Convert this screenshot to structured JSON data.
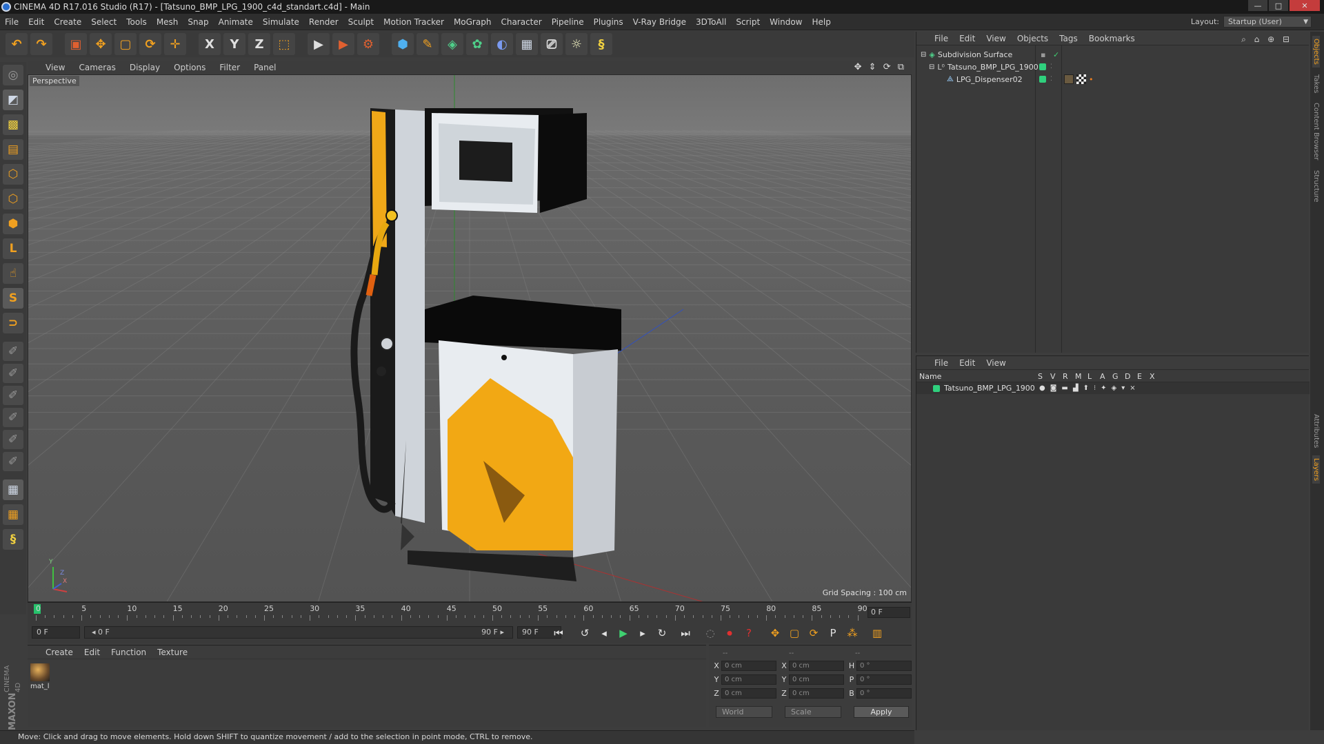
{
  "window": {
    "title": "CINEMA 4D R17.016 Studio (R17) - [Tatsuno_BMP_LPG_1900_c4d_standart.c4d] - Main",
    "buttons": [
      "—",
      "□",
      "✕"
    ]
  },
  "menubar": {
    "items": [
      "File",
      "Edit",
      "Create",
      "Select",
      "Tools",
      "Mesh",
      "Snap",
      "Animate",
      "Simulate",
      "Render",
      "Sculpt",
      "Motion Tracker",
      "MoGraph",
      "Character",
      "Pipeline",
      "Plugins",
      "V-Ray Bridge",
      "3DToAll",
      "Script",
      "Window",
      "Help"
    ],
    "layout_label": "Layout:",
    "layout_value": "Startup (User)"
  },
  "toolbar": {
    "buttons": [
      {
        "name": "undo-icon",
        "glyph": "↶"
      },
      {
        "name": "redo-icon",
        "glyph": "↷"
      },
      {
        "name": "select-icon",
        "glyph": "▣"
      },
      {
        "name": "move-icon",
        "glyph": "✥"
      },
      {
        "name": "scale-icon",
        "glyph": "▢"
      },
      {
        "name": "rotate-icon",
        "glyph": "⟳"
      },
      {
        "name": "transform-icon",
        "glyph": "✛"
      },
      {
        "name": "x-axis-icon",
        "glyph": "X"
      },
      {
        "name": "y-axis-icon",
        "glyph": "Y"
      },
      {
        "name": "z-axis-icon",
        "glyph": "Z"
      },
      {
        "name": "coord-system-icon",
        "glyph": "⬚"
      },
      {
        "name": "render-view-icon",
        "glyph": "▶"
      },
      {
        "name": "render-picture-icon",
        "glyph": "▶"
      },
      {
        "name": "render-settings-icon",
        "glyph": "⚙"
      },
      {
        "name": "cube-icon",
        "glyph": "⬢"
      },
      {
        "name": "pen-icon",
        "glyph": "✎"
      },
      {
        "name": "subdivision-icon",
        "glyph": "◈"
      },
      {
        "name": "mograph-icon",
        "glyph": "✿"
      },
      {
        "name": "deformer-icon",
        "glyph": "◐"
      },
      {
        "name": "floor-icon",
        "glyph": "▦"
      },
      {
        "name": "camera-icon",
        "glyph": "⎚"
      },
      {
        "name": "light-icon",
        "glyph": "☼"
      },
      {
        "name": "python-icon",
        "glyph": "§"
      }
    ]
  },
  "lefttools": [
    {
      "name": "make-editable-icon",
      "glyph": "◎"
    },
    {
      "name": "model-mode-icon",
      "glyph": "◩"
    },
    {
      "name": "texture-mode-icon",
      "glyph": "▩"
    },
    {
      "name": "workplane-icon",
      "glyph": "▤"
    },
    {
      "name": "points-mode-icon",
      "glyph": "⬡"
    },
    {
      "name": "edges-mode-icon",
      "glyph": "⬡"
    },
    {
      "name": "polygons-mode-icon",
      "glyph": "⬢"
    },
    {
      "name": "axis-mode-icon",
      "glyph": "L"
    },
    {
      "name": "tweak-icon",
      "glyph": "☝"
    },
    {
      "name": "snap-icon",
      "glyph": "S"
    },
    {
      "name": "magnet-icon",
      "glyph": "⊃"
    },
    {
      "name": "brush-1-icon",
      "glyph": "✐"
    },
    {
      "name": "brush-2-icon",
      "glyph": "✐"
    },
    {
      "name": "brush-3-icon",
      "glyph": "✐"
    },
    {
      "name": "brush-4-icon",
      "glyph": "✐"
    },
    {
      "name": "brush-5-icon",
      "glyph": "✐"
    },
    {
      "name": "brush-6-icon",
      "glyph": "✐"
    },
    {
      "name": "lock-grid-icon",
      "glyph": "▦"
    },
    {
      "name": "grid-snap-icon",
      "glyph": "▦"
    },
    {
      "name": "python-script-icon",
      "glyph": "§"
    }
  ],
  "maxon": {
    "line1": "MAXON",
    "line2": "CINEMA 4D"
  },
  "viewport": {
    "menu": [
      "View",
      "Cameras",
      "Display",
      "Options",
      "Filter",
      "Panel"
    ],
    "nav_icons": "✥ ⇕ ⟳ ⧉",
    "label": "Perspective",
    "grid_spacing": "Grid Spacing : 100 cm",
    "axis_y": "Y",
    "axis_z": "Z",
    "axis_x": "X"
  },
  "timeline": {
    "ticks": [
      "0",
      "5",
      "10",
      "15",
      "20",
      "25",
      "30",
      "35",
      "40",
      "45",
      "50",
      "55",
      "60",
      "65",
      "70",
      "75",
      "80",
      "85",
      "90"
    ],
    "current_frame": "0 F"
  },
  "transport": {
    "start": "0 F",
    "scrub_left": "◂ 0 F",
    "scrub_right": "90 F ▸",
    "end": "90 F",
    "buttons": [
      {
        "name": "goto-start-icon",
        "glyph": "⏮"
      },
      {
        "name": "prev-key-icon",
        "glyph": "↺"
      },
      {
        "name": "prev-frame-icon",
        "glyph": "◂"
      },
      {
        "name": "play-icon",
        "glyph": "▶"
      },
      {
        "name": "next-frame-icon",
        "glyph": "▸"
      },
      {
        "name": "loop-icon",
        "glyph": "↻"
      },
      {
        "name": "goto-end-icon",
        "glyph": "⏭"
      },
      {
        "name": "record-off-icon",
        "glyph": "◌"
      },
      {
        "name": "record-icon",
        "glyph": "⏺"
      },
      {
        "name": "autokey-icon",
        "glyph": "?"
      },
      {
        "name": "key-move-icon",
        "glyph": "✥"
      },
      {
        "name": "key-scale-icon",
        "glyph": "▢"
      },
      {
        "name": "key-rotate-icon",
        "glyph": "⟳"
      },
      {
        "name": "key-param-icon",
        "glyph": "P"
      },
      {
        "name": "key-pla-icon",
        "glyph": "⁂"
      },
      {
        "name": "timeline-layout-icon",
        "glyph": "▥"
      }
    ]
  },
  "material": {
    "menu": [
      "Create",
      "Edit",
      "Function",
      "Texture"
    ],
    "mat_name": "mat_l"
  },
  "coords": {
    "headers": [
      "--",
      "--",
      "--"
    ],
    "rows": [
      {
        "a": "X",
        "av": "0 cm",
        "b": "X",
        "bv": "0 cm",
        "c": "H",
        "cv": "0 °"
      },
      {
        "a": "Y",
        "av": "0 cm",
        "b": "Y",
        "bv": "0 cm",
        "c": "P",
        "cv": "0 °"
      },
      {
        "a": "Z",
        "av": "0 cm",
        "b": "Z",
        "bv": "0 cm",
        "c": "B",
        "cv": "0 °"
      }
    ],
    "world": "World",
    "scale": "Scale",
    "apply": "Apply"
  },
  "status": "Move: Click and drag to move elements. Hold down SHIFT to quantize movement / add to the selection in point mode, CTRL to remove.",
  "objects": {
    "menu": [
      "File",
      "Edit",
      "View",
      "Objects",
      "Tags",
      "Bookmarks"
    ],
    "items": [
      {
        "name": "Subdivision Surface"
      },
      {
        "name": "Tatsuno_BMP_LPG_1900"
      },
      {
        "name": "LPG_Dispenser02"
      }
    ]
  },
  "layers": {
    "menu": [
      "File",
      "Edit",
      "View"
    ],
    "columns": [
      "Name",
      "S",
      "V",
      "R",
      "M",
      "L",
      "A",
      "G",
      "D",
      "E",
      "X"
    ],
    "row_name": "Tatsuno_BMP_LPG_1900"
  },
  "right_tabs": [
    "Objects",
    "Takes",
    "Content Browser",
    "Structure",
    "Attributes",
    "Layers"
  ],
  "colors": {
    "accent": "#f0a020",
    "green": "#2fd07d",
    "pump_yellow": "#f2a814"
  }
}
